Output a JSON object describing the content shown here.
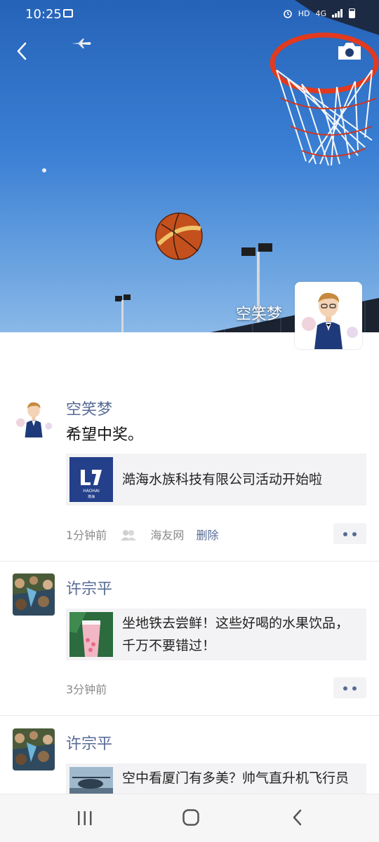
{
  "status_bar": {
    "time": "10:25",
    "hd": "HD",
    "network": "4G"
  },
  "cover": {
    "user_name": "空笑梦"
  },
  "posts": [
    {
      "nickname": "空笑梦",
      "text": "希望中奖。",
      "link": {
        "title": "澔海水族科技有限公司活动开始啦",
        "thumb_brand": "HAOHAI",
        "thumb_sub": "澔海"
      },
      "time": "1分钟前",
      "source": "海友网",
      "delete_label": "删除"
    },
    {
      "nickname": "许宗平",
      "link": {
        "title_line1": "坐地铁去尝鲜！这些好喝的水果饮品，",
        "title_line2": "千万不要错过！"
      },
      "time": "3分钟前"
    },
    {
      "nickname": "许宗平",
      "link": {
        "title_line1": "空中看厦门有多美？帅气直升机飞行员"
      }
    }
  ],
  "icons": {
    "back": "back-arrow-icon",
    "camera": "camera-icon",
    "more": "more-dots-icon",
    "friends": "friends-icon",
    "nav_recent": "recent-apps-icon",
    "nav_home": "home-icon",
    "nav_back": "nav-back-icon"
  },
  "colors": {
    "nickname": "#576b95",
    "sky": "#3a7fd4",
    "link_card_bg": "#f3f3f5"
  }
}
